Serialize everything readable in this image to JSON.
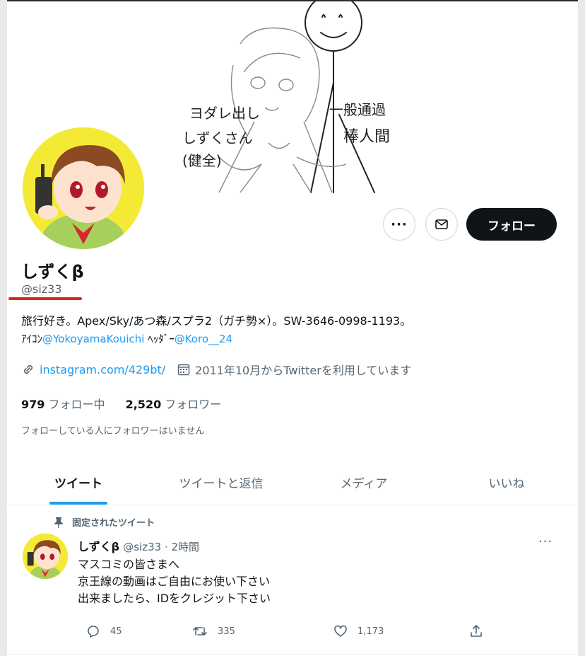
{
  "header": {
    "art_text_left_1": "ヨダレ出し",
    "art_text_left_2": "しずくさん",
    "art_text_left_3": "(健全)",
    "art_text_right_1": "一般通過",
    "art_text_right_2": "棒人間"
  },
  "profile": {
    "name": "しずくβ",
    "handle": "@siz33",
    "bio_line1": "旅行好き。Apex/Sky/あつ森/スプラ2（ガチ勢×）。SW-3646-0998-1193。",
    "bio_line2_prefix": "ｱｲｺﾝ",
    "bio_line2_link1": "@YokoyamaKouichi",
    "bio_line2_mid": " ﾍｯﾀﾞｰ",
    "bio_line2_link2": "@Koro__24",
    "website": "instagram.com/429bt/",
    "joined": "2011年10月からTwitterを利用しています",
    "following_count": "979",
    "following_label": " フォロー中",
    "followers_count": "2,520",
    "followers_label": " フォロワー",
    "followers_note": "フォローしている人にフォロワーはいません"
  },
  "buttons": {
    "more": "···",
    "follow": "フォロー"
  },
  "tabs": [
    {
      "label": "ツイート",
      "active": true
    },
    {
      "label": "ツイートと返信",
      "active": false
    },
    {
      "label": "メディア",
      "active": false
    },
    {
      "label": "いいね",
      "active": false
    }
  ],
  "tweet": {
    "pinned_label": "固定されたツイート",
    "author_name": "しずくβ",
    "author_handle": "@siz33",
    "time": "2時間",
    "more": "···",
    "lines": [
      "マスコミの皆さまへ",
      "京王線の動画はご自由にお使い下さい",
      "出来ましたら、IDをクレジット下さい"
    ],
    "replies": "45",
    "retweets": "335",
    "likes": "1,173"
  },
  "colors": {
    "accent": "#1d9bf0",
    "text": "#0f1419",
    "secondary": "#536471",
    "annotation_red": "#d82a1d"
  }
}
